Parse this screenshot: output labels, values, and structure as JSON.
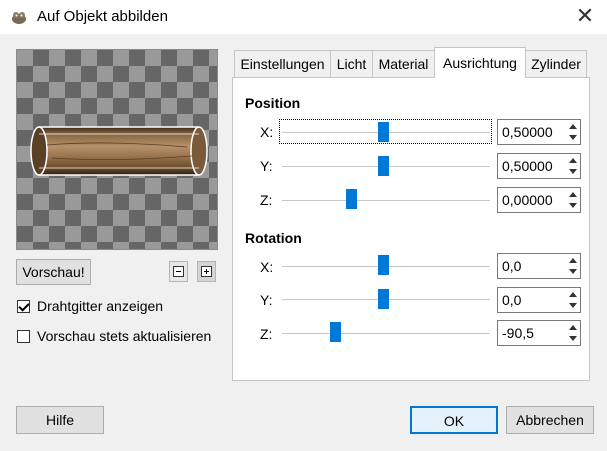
{
  "window": {
    "title": "Auf Objekt abbilden",
    "close_glyph": "✕"
  },
  "preview": {
    "button_label": "Vorschau!",
    "wireframe_label": "Drahtgitter anzeigen",
    "wireframe_checked": true,
    "auto_update_label": "Vorschau stets aktualisieren",
    "auto_update_checked": false
  },
  "tabs": [
    {
      "label": "Einstellungen",
      "active": false
    },
    {
      "label": "Licht",
      "active": false
    },
    {
      "label": "Material",
      "active": false
    },
    {
      "label": "Ausrichtung",
      "active": true
    },
    {
      "label": "Zylinder",
      "active": false
    }
  ],
  "orientation": {
    "position_title": "Position",
    "position": [
      {
        "axis": "X:",
        "value": "0,50000",
        "slider": 0.5
      },
      {
        "axis": "Y:",
        "value": "0,50000",
        "slider": 0.5
      },
      {
        "axis": "Z:",
        "value": "0,00000",
        "slider": 0.33
      }
    ],
    "rotation_title": "Rotation",
    "rotation": [
      {
        "axis": "X:",
        "value": "0,0",
        "slider": 0.5
      },
      {
        "axis": "Y:",
        "value": "0,0",
        "slider": 0.5
      },
      {
        "axis": "Z:",
        "value": "-90,5",
        "slider": 0.25
      }
    ]
  },
  "footer": {
    "help_label": "Hilfe",
    "ok_label": "OK",
    "cancel_label": "Abbrechen"
  },
  "colors": {
    "accent": "#0078d7",
    "dialog_bg": "#f0f0f0"
  }
}
